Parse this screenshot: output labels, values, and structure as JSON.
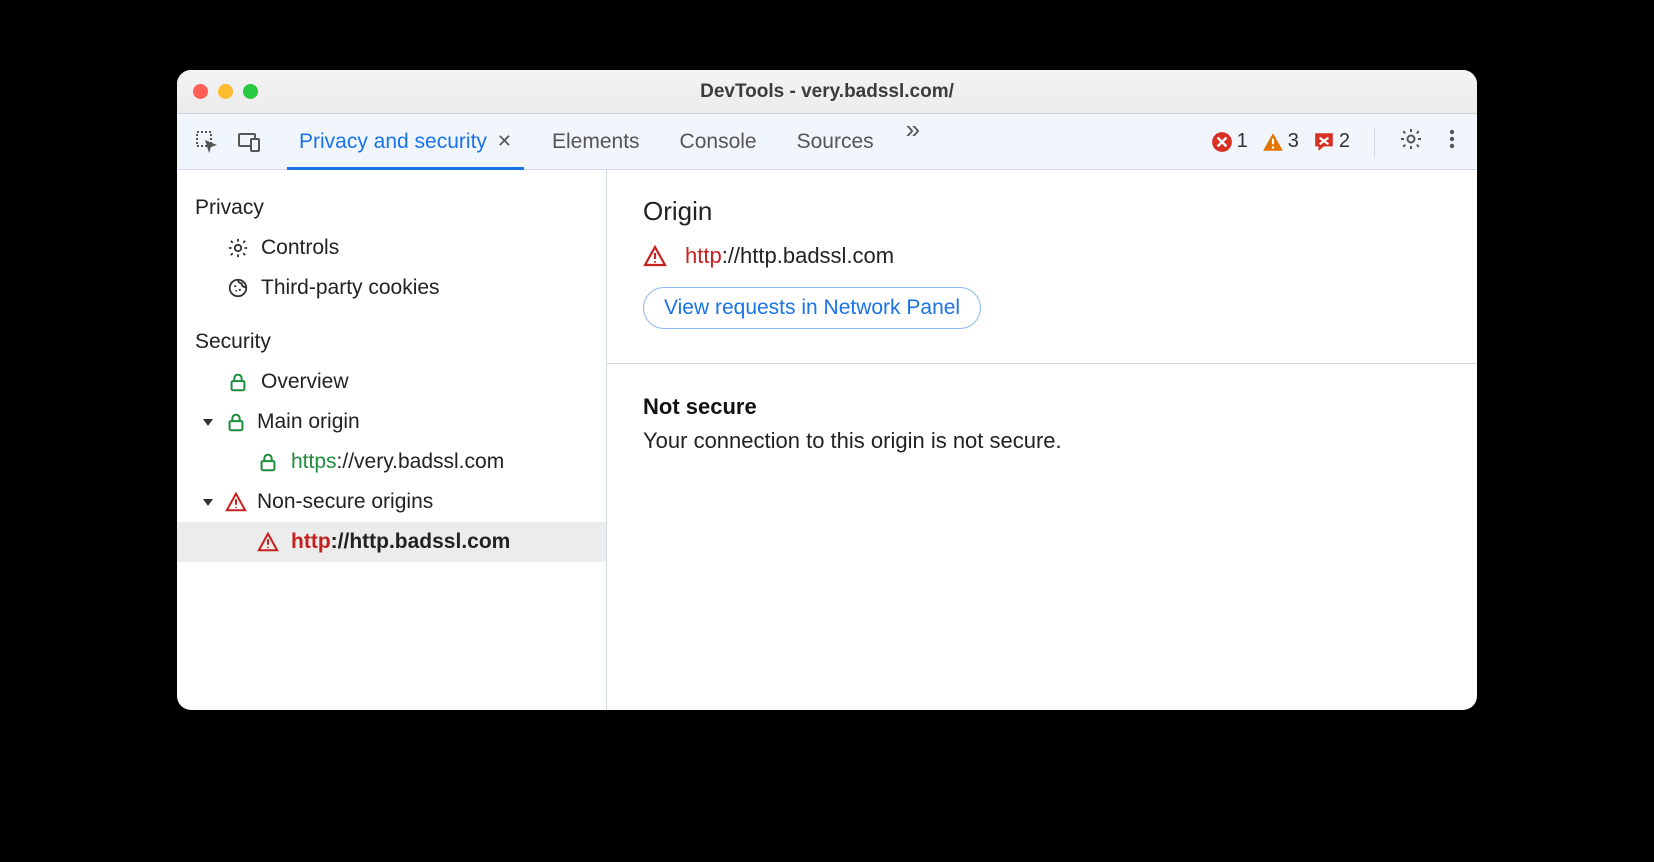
{
  "window": {
    "title": "DevTools - very.badssl.com/"
  },
  "toolbar": {
    "tabs": {
      "active": "Privacy and security",
      "others": [
        "Elements",
        "Console",
        "Sources"
      ]
    },
    "errors": 1,
    "warnings": 3,
    "issues": 2
  },
  "sidebar": {
    "groups": [
      {
        "title": "Privacy",
        "items": [
          {
            "icon": "gear",
            "label": "Controls"
          },
          {
            "icon": "cookie",
            "label": "Third-party cookies"
          }
        ]
      },
      {
        "title": "Security",
        "items": [
          {
            "icon": "lock",
            "label": "Overview"
          }
        ],
        "expandable": [
          {
            "icon": "lock",
            "label": "Main origin",
            "children": [
              {
                "icon": "lock",
                "scheme": "https",
                "rest": "://very.badssl.com"
              }
            ]
          },
          {
            "icon": "warn",
            "label": "Non-secure origins",
            "children": [
              {
                "icon": "warn",
                "scheme": "http",
                "rest": "://http.badssl.com",
                "selected": true
              }
            ]
          }
        ]
      }
    ]
  },
  "main": {
    "origin_heading": "Origin",
    "origin": {
      "scheme": "http",
      "rest": "://http.badssl.com"
    },
    "network_link": "View requests in Network Panel",
    "status_title": "Not secure",
    "status_body": "Your connection to this origin is not secure."
  }
}
